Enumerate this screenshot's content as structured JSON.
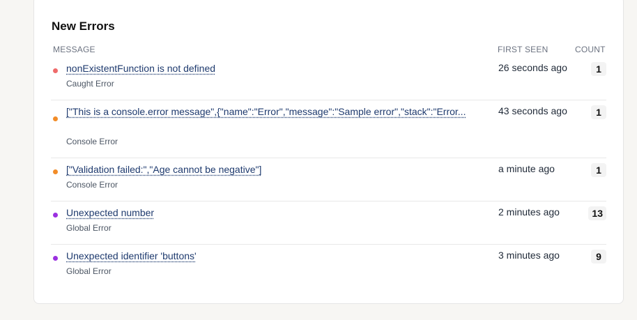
{
  "panel": {
    "title": "New Errors",
    "columns": {
      "message": "MESSAGE",
      "first_seen": "FIRST SEEN",
      "count": "COUNT"
    }
  },
  "colors": {
    "caught": "#ef6b6b",
    "console": "#f28c28",
    "global": "#9b30e0"
  },
  "errors": [
    {
      "message": "nonExistentFunction is not defined",
      "type": "Caught Error",
      "first_seen": "26 seconds ago",
      "count": "1"
    },
    {
      "message": "[\"This is a console.error message\",{\"name\":\"Error\",\"message\":\"Sample error\",\"stack\":\"Error...",
      "type": "Console Error",
      "first_seen": "43 seconds ago",
      "count": "1"
    },
    {
      "message": "[\"Validation failed:\",\"Age cannot be negative\"]",
      "type": "Console Error",
      "first_seen": "a minute ago",
      "count": "1"
    },
    {
      "message": "Unexpected number",
      "type": "Global Error",
      "first_seen": "2 minutes ago",
      "count": "13"
    },
    {
      "message": "Unexpected identifier 'buttons'",
      "type": "Global Error",
      "first_seen": "3 minutes ago",
      "count": "9"
    }
  ]
}
